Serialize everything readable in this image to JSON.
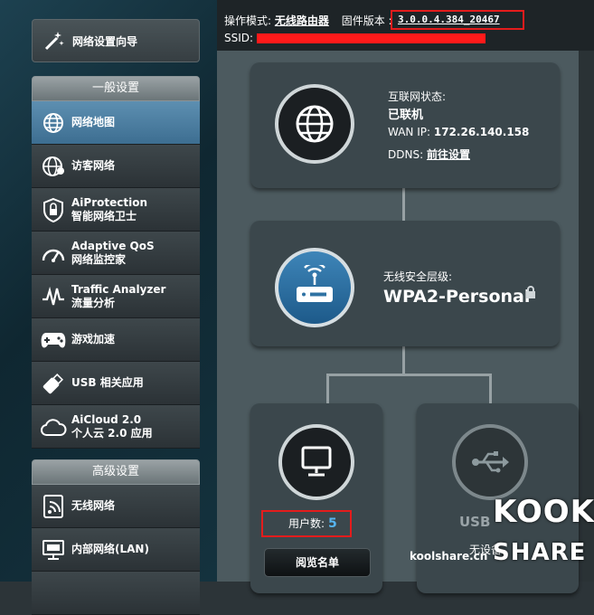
{
  "header": {
    "mode_label": "操作模式:",
    "mode_value": "无线路由器",
    "fw_label": "固件版本 :",
    "fw_value": "3.0.0.4.384_20467",
    "ssid_label": "SSID:"
  },
  "sidebar": {
    "wizard": "网络设置向导",
    "general_header": "一般设置",
    "advanced_header": "高级设置",
    "general_items": [
      {
        "line1": "网络地图",
        "line2": ""
      },
      {
        "line1": "访客网络",
        "line2": ""
      },
      {
        "line1": "AiProtection",
        "line2": "智能网络卫士"
      },
      {
        "line1": "Adaptive QoS",
        "line2": "网络监控家"
      },
      {
        "line1": "Traffic Analyzer",
        "line2": "流量分析"
      },
      {
        "line1": "游戏加速",
        "line2": ""
      },
      {
        "line1": "USB 相关应用",
        "line2": ""
      },
      {
        "line1": "AiCloud 2.0",
        "line2": "个人云 2.0 应用"
      }
    ],
    "advanced_items": [
      {
        "line1": "无线网络",
        "line2": ""
      },
      {
        "line1": "内部网络(LAN)",
        "line2": ""
      }
    ]
  },
  "internet": {
    "status_label": "互联网状态:",
    "status_value": "已联机",
    "wan_label": "WAN IP:",
    "wan_value": "172.26.140.158",
    "ddns_label": "DDNS:",
    "ddns_link": "前往设置"
  },
  "wireless": {
    "security_label": "无线安全层级:",
    "security_value": "WPA2-Personal"
  },
  "clients": {
    "count_label": "用户数:",
    "count_value": "5",
    "view_button": "阅览名单"
  },
  "usb": {
    "label": "USB",
    "status": "无设备"
  },
  "watermark": {
    "site": "koolshare.cn",
    "brand_top": "KOOK",
    "brand_bottom": "SHARE"
  }
}
